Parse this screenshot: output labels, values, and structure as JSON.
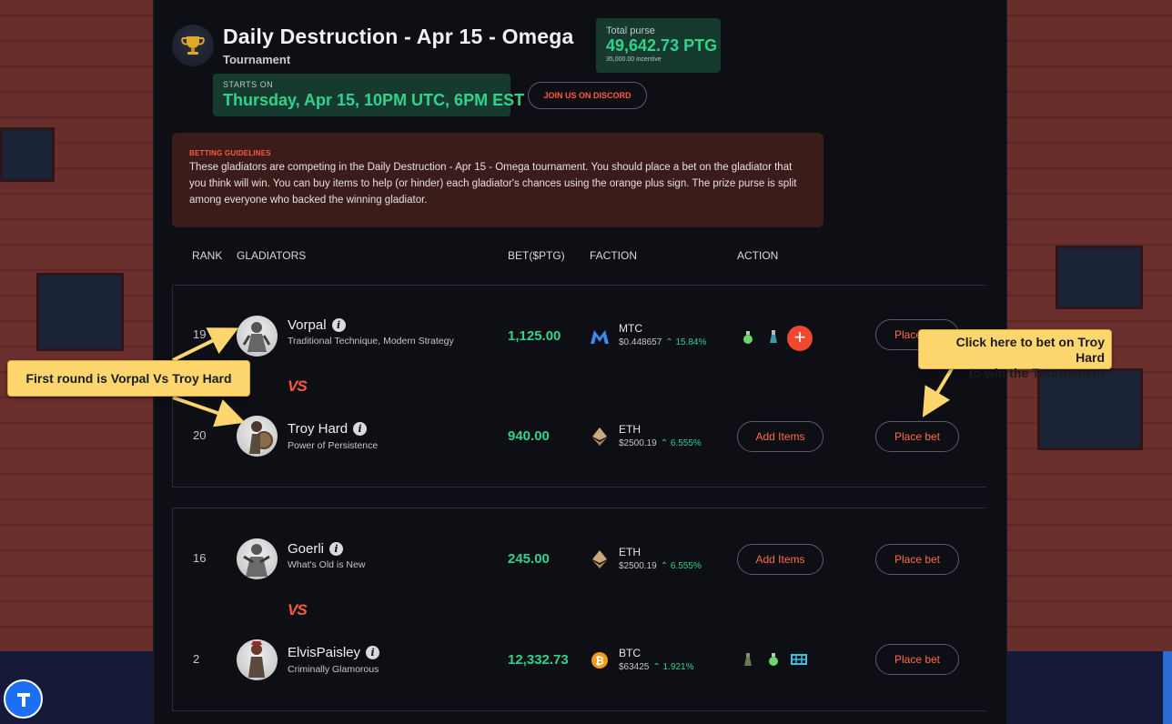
{
  "header": {
    "title": "Daily Destruction - Apr 15 - Omega",
    "subtitle": "Tournament",
    "starts_label": "STARTS ON",
    "starts_value": "Thursday, Apr 15, 10PM UTC, 6PM EST",
    "purse_label": "Total purse",
    "purse_value": "49,642.73 PTG",
    "purse_incentive": "35,000.00 incentive",
    "discord_label": "JOIN US ON DISCORD"
  },
  "guidelines": {
    "label": "BETTING GUIDELINES",
    "text": "These gladiators are competing in the Daily Destruction - Apr 15 - Omega tournament. You should place a bet on the gladiator that you think will win. You can buy items to help (or hinder) each gladiator's chances using the orange plus sign. The prize purse is split among everyone who backed the winning gladiator."
  },
  "table": {
    "headers": {
      "rank": "RANK",
      "gladiators": "GLADIATORS",
      "bet": "BET($PTG)",
      "faction": "FACTION",
      "action": "ACTION"
    },
    "vs_label": "VS",
    "matchups": [
      {
        "rows": [
          {
            "rank": "19",
            "name": "Vorpal",
            "desc": "Traditional Technique, Modern Strategy",
            "bet": "1,125.00",
            "faction": "MTC",
            "price": "$0.448657",
            "change": "15.84%",
            "coin": "mtc-icon",
            "add_items": "",
            "place_bet": "Place bet"
          },
          {
            "rank": "20",
            "name": "Troy Hard",
            "desc": "Power of Persistence",
            "bet": "940.00",
            "faction": "ETH",
            "price": "$2500.19",
            "change": "6.555%",
            "coin": "eth-icon",
            "add_items": "Add Items",
            "place_bet": "Place bet"
          }
        ]
      },
      {
        "rows": [
          {
            "rank": "16",
            "name": "Goerli",
            "desc": "What's Old is New",
            "bet": "245.00",
            "faction": "ETH",
            "price": "$2500.19",
            "change": "6.555%",
            "coin": "eth-icon",
            "add_items": "Add Items",
            "place_bet": "Place bet"
          },
          {
            "rank": "2",
            "name": "ElvisPaisley",
            "desc": "Criminally Glamorous",
            "bet": "12,332.73",
            "faction": "BTC",
            "price": "$63425",
            "change": "1.921%",
            "coin": "btc-icon",
            "add_items": "",
            "place_bet": "Place bet"
          }
        ]
      }
    ]
  },
  "annotations": {
    "first_round": "First round is Vorpal Vs Troy Hard",
    "click_here_line1": "Click here to bet on Troy Hard",
    "click_here_line2": "to win the Tournament"
  },
  "colors": {
    "accent_green": "#2fd38e",
    "accent_orange": "#ff5a3c",
    "panel_bg": "#0e0f14",
    "callout_yellow": "#fdd66e"
  }
}
